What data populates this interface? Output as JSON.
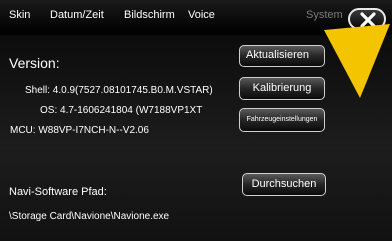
{
  "tabs": [
    {
      "label": "Skin"
    },
    {
      "label": "Datum/Zeit"
    },
    {
      "label": "Bildschirm"
    },
    {
      "label": "Voice"
    },
    {
      "label": "System",
      "active": true
    }
  ],
  "icons": {
    "close": "close-x-icon",
    "arrow": "pointer-arrow-icon"
  },
  "colors": {
    "pointer_arrow": "#f5c400",
    "inactive_tab": "#7a7a7a"
  },
  "version": {
    "label": "Version:",
    "shell": "Shell: 4.0.9(7527.08101745.B0.M.VSTAR)",
    "os": "OS:  4.7-1606241804 (W7188VP1XT",
    "mcu": "MCU:  W88VP-I7NCH-N--V2.06"
  },
  "buttons": {
    "update": "Aktualisieren",
    "calibration": "Kalibrierung",
    "vehicle_settings": "Fahrzeugeinstellungen",
    "browse": "Durchsuchen"
  },
  "navi": {
    "label": "Navi-Software Pfad:",
    "path": "\\Storage Card\\Navione\\Navione.exe"
  }
}
